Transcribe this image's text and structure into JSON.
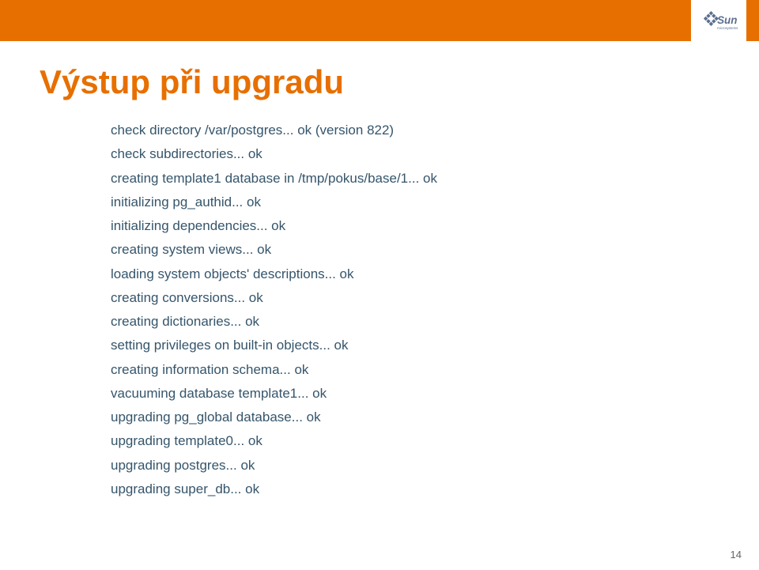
{
  "title": "Výstup při upgradu",
  "lines": [
    "check directory /var/postgres... ok (version 822)",
    "check subdirectories... ok",
    "creating template1 database in /tmp/pokus/base/1... ok",
    "initializing pg_authid... ok",
    "initializing dependencies... ok",
    "creating system views... ok",
    "loading system objects' descriptions... ok",
    "creating conversions... ok",
    "creating dictionaries... ok",
    "setting privileges on built-in objects... ok",
    "creating information schema... ok",
    "vacuuming database template1... ok",
    "upgrading pg_global database... ok",
    "upgrading template0... ok",
    "upgrading postgres... ok",
    "upgrading super_db... ok"
  ],
  "page_number": "14",
  "logo": {
    "brand": "Sun",
    "sub": "microsystems"
  }
}
